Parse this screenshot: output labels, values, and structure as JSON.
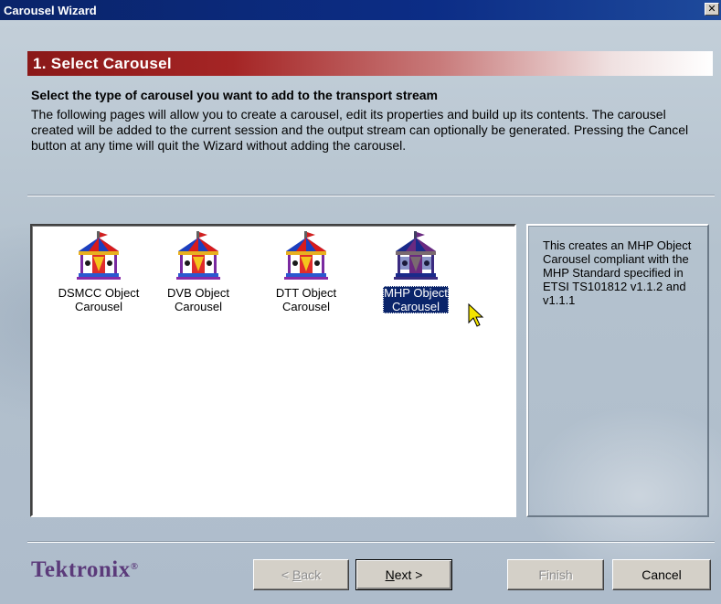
{
  "window": {
    "title": "Carousel Wizard",
    "close_label": "✕"
  },
  "banner": {
    "title": "1. Select Carousel"
  },
  "subtitle": "Select the type of carousel you want to add to the transport stream",
  "intro": "The following pages will allow you to create a carousel, edit its properties and build up its contents. The carousel created will be added to the current session and the output stream can optionally be generated. Pressing the Cancel button at any time will quit the Wizard without adding the carousel.",
  "carousel_types": [
    {
      "line1": "DSMCC Object",
      "line2": "Carousel",
      "selected": false,
      "icon": "carousel-icon"
    },
    {
      "line1": "DVB Object",
      "line2": "Carousel",
      "selected": false,
      "icon": "carousel-icon"
    },
    {
      "line1": "DTT Object",
      "line2": "Carousel",
      "selected": false,
      "icon": "carousel-icon"
    },
    {
      "line1": "MHP Object",
      "line2": "Carousel",
      "selected": true,
      "icon": "carousel-icon"
    }
  ],
  "description": "This creates an MHP Object Carousel compliant with the MHP Standard specified in ETSI TS101812 v1.1.2 and v1.1.1",
  "logo": {
    "text": "Tektronix",
    "mark": "®"
  },
  "buttons": {
    "back_label": "Back",
    "back_mnemonic": "B",
    "next_label": "Next >",
    "next_mnemonic": "N",
    "finish_label": "Finish",
    "cancel_label": "Cancel"
  },
  "colors": {
    "title_bar": "#0a246a",
    "banner_red": "#a52525",
    "selection": "#0a246a",
    "logo": "#5b3a7a"
  }
}
